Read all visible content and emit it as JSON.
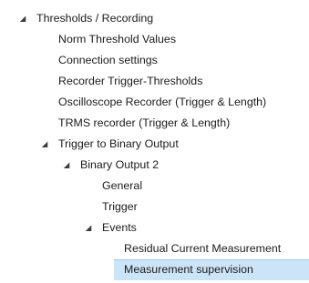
{
  "tree": {
    "items": [
      {
        "id": "thresholds-recording",
        "label": "Thresholds / Recording",
        "level": 0,
        "expanded": true,
        "has_children": true,
        "selected": false
      },
      {
        "id": "norm-threshold-values",
        "label": "Norm Threshold Values",
        "level": 1,
        "expanded": false,
        "has_children": false,
        "selected": false
      },
      {
        "id": "connection-settings",
        "label": "Connection settings",
        "level": 1,
        "expanded": false,
        "has_children": false,
        "selected": false
      },
      {
        "id": "recorder-trigger-thresholds",
        "label": "Recorder Trigger-Thresholds",
        "level": 1,
        "expanded": false,
        "has_children": false,
        "selected": false
      },
      {
        "id": "oscilloscope-recorder",
        "label": "Oscilloscope Recorder (Trigger & Length)",
        "level": 1,
        "expanded": false,
        "has_children": false,
        "selected": false
      },
      {
        "id": "trms-recorder",
        "label": "TRMS recorder (Trigger & Length)",
        "level": 1,
        "expanded": false,
        "has_children": false,
        "selected": false
      },
      {
        "id": "trigger-to-binary-output",
        "label": "Trigger to Binary Output",
        "level": 1,
        "expanded": true,
        "has_children": true,
        "selected": false
      },
      {
        "id": "binary-output-2",
        "label": "Binary Output 2",
        "level": 2,
        "expanded": true,
        "has_children": true,
        "selected": false
      },
      {
        "id": "general",
        "label": "General",
        "level": 3,
        "expanded": false,
        "has_children": false,
        "selected": false
      },
      {
        "id": "trigger",
        "label": "Trigger",
        "level": 3,
        "expanded": false,
        "has_children": false,
        "selected": false
      },
      {
        "id": "events",
        "label": "Events",
        "level": 3,
        "expanded": true,
        "has_children": true,
        "selected": false
      },
      {
        "id": "residual-current-measurement",
        "label": "Residual Current Measurement",
        "level": 4,
        "expanded": false,
        "has_children": false,
        "selected": false
      },
      {
        "id": "measurement-supervision",
        "label": "Measurement supervision",
        "level": 4,
        "expanded": false,
        "has_children": false,
        "selected": true
      }
    ],
    "expanded_glyph": "◢",
    "colors": {
      "selection_background": "#cce4f7",
      "selection_border": "#99c9ef",
      "text": "#1b1b1b"
    }
  }
}
